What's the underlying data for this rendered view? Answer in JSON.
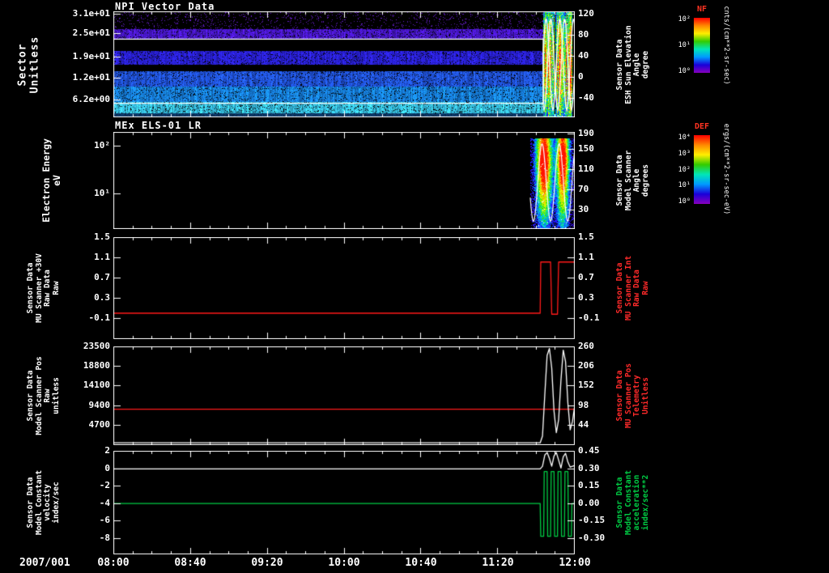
{
  "page": {
    "background": "#000000",
    "date_label": "2007/001",
    "x_tick_labels": [
      "08:00",
      "08:40",
      "09:20",
      "10:00",
      "10:40",
      "11:20",
      "12:00"
    ],
    "time_range_hours": [
      8,
      12
    ]
  },
  "colorbars": [
    {
      "name": "NF",
      "title": "NF",
      "title_color": "#ff3322",
      "unit": "cnts/(cm**2-sr-sec)",
      "tick_labels": [
        "10²",
        "10¹",
        "10⁰"
      ],
      "tick_fracs": [
        0.03,
        0.5,
        0.97
      ],
      "gradient": [
        "#ff0000",
        "#ff8800",
        "#ffee00",
        "#33cc00",
        "#00e6b8",
        "#0099ff",
        "#1a00d9",
        "#8800bb"
      ]
    },
    {
      "name": "DEF",
      "title": "DEF",
      "title_color": "#ff3322",
      "unit": "ergs/(cm**2-sr-sec-eV)",
      "tick_labels": [
        "10⁴",
        "10³",
        "10²",
        "10¹",
        "10⁰"
      ],
      "tick_fracs": [
        0.03,
        0.265,
        0.5,
        0.735,
        0.97
      ],
      "gradient": [
        "#ff0000",
        "#ff8800",
        "#ffee00",
        "#33cc00",
        "#00e6b8",
        "#0099ff",
        "#1a00d9",
        "#8800bb"
      ]
    }
  ],
  "chart_data": [
    {
      "type": "heatmap",
      "title": "NPI Vector Data",
      "ylabel_left": "Sector\nUnitless",
      "ylabel_right": "Sensor Data\nESH Sun Elevation\nAngle\ndegree",
      "ylabel_right_color": "#ffffff",
      "yticks_left": {
        "labels": [
          "3.1e+01",
          "2.5e+01",
          "1.9e+01",
          "1.2e+01",
          "6.2e+00"
        ],
        "fracs": [
          0.02,
          0.21,
          0.43,
          0.63,
          0.84
        ]
      },
      "yticks_right": {
        "labels": [
          "120",
          "80",
          "40",
          "0",
          "-40"
        ],
        "fracs": [
          0.02,
          0.22,
          0.42,
          0.62,
          0.82
        ]
      },
      "colorbar": "NF",
      "bands": [
        {
          "sector_frac": [
            0.0,
            0.17
          ],
          "level": "sparse",
          "color": [
            110,
            30,
            220
          ]
        },
        {
          "sector_frac": [
            0.17,
            0.265
          ],
          "level": "dense",
          "color": [
            80,
            25,
            225
          ]
        },
        {
          "sector_frac": [
            0.265,
            0.375
          ],
          "level": "off",
          "color": [
            0,
            0,
            0
          ]
        },
        {
          "sector_frac": [
            0.375,
            0.5
          ],
          "level": "dense",
          "color": [
            45,
            35,
            235
          ]
        },
        {
          "sector_frac": [
            0.5,
            0.565
          ],
          "level": "off",
          "color": [
            0,
            0,
            0
          ]
        },
        {
          "sector_frac": [
            0.565,
            0.71
          ],
          "level": "dense",
          "color": [
            35,
            90,
            240
          ]
        },
        {
          "sector_frac": [
            0.71,
            0.855
          ],
          "level": "dense",
          "color": [
            25,
            140,
            245
          ]
        },
        {
          "sector_frac": [
            0.855,
            0.965
          ],
          "level": "dense",
          "color": [
            60,
            210,
            250
          ]
        },
        {
          "sector_frac": [
            0.965,
            1.0
          ],
          "level": "dim",
          "color": [
            15,
            70,
            130
          ]
        }
      ],
      "event_x_hours": [
        11.73,
        12.0
      ],
      "overlay_lines": [
        {
          "color": "#ffffff",
          "const_frac": 0.262,
          "oscillates_in_event": true
        },
        {
          "color": "#ffffff",
          "const_frac": 0.868,
          "oscillates_in_event": true
        }
      ]
    },
    {
      "type": "heatmap",
      "title": "MEx ELS-01 LR",
      "ylabel_left": "Electron Energy\neV",
      "ylabel_right": "Sensor Data\nModel Scanner\nAngle\ndegrees",
      "ylabel_right_color": "#ffffff",
      "yticks_left": {
        "labels": [
          "10²",
          "10¹"
        ],
        "fracs": [
          0.14,
          0.64
        ]
      },
      "yticks_right": {
        "labels": [
          "190",
          "150",
          "110",
          "70",
          "30"
        ],
        "fracs": [
          0.02,
          0.175,
          0.39,
          0.6,
          0.81
        ]
      },
      "colorbar": "DEF",
      "event_x_hours": [
        11.62,
        12.0
      ],
      "event_blobs": [
        {
          "center_frac": 0.3,
          "width_frac": 0.16
        },
        {
          "center_frac": 0.72,
          "width_frac": 0.13
        }
      ],
      "overlay_lines": [
        {
          "color": "#ffffff",
          "oscillates_in_event": true
        }
      ]
    },
    {
      "type": "line",
      "title": "",
      "ylabel_left": "Sensor Data\nMU Scanner +30V\nRaw Data\nRaw",
      "ylabel_right": "Sensor Data\nMU Scanner Int\nRaw Data\nRaw",
      "ylabel_right_color": "#ff2a2a",
      "ylim": [
        -0.5,
        1.5
      ],
      "yticks_left": {
        "labels": [
          "1.5",
          "1.1",
          "0.7",
          "0.3",
          "-0.1"
        ],
        "values": [
          1.5,
          1.1,
          0.7,
          0.3,
          -0.1
        ]
      },
      "yticks_right": {
        "labels": [
          "1.5",
          "1.1",
          "0.7",
          "0.3",
          "-0.1"
        ],
        "values": [
          1.5,
          1.1,
          0.7,
          0.3,
          -0.1
        ]
      },
      "series": [
        {
          "name": "MU Scanner +30V Raw Data",
          "color": "#ff1a1a",
          "points": [
            [
              8,
              0
            ],
            [
              11.7,
              0
            ],
            [
              11.705,
              1.02
            ],
            [
              11.79,
              1.02
            ],
            [
              11.8,
              -0.02
            ],
            [
              11.85,
              -0.02
            ],
            [
              11.86,
              1.02
            ],
            [
              12,
              1.02
            ]
          ]
        }
      ]
    },
    {
      "type": "line",
      "title": "",
      "ylabel_left": "Sensor Data\nModel Scanner Pos\nRaw\nunitless",
      "ylabel_right": "Sensor Data\nMU Scanner Pos\nTelemetry\nUnitless",
      "ylabel_right_color": "#ff2a2a",
      "ylim": [
        0,
        23500
      ],
      "yticks_left": {
        "labels": [
          "23500",
          "18800",
          "14100",
          "9400",
          "4700"
        ],
        "values": [
          23500,
          18800,
          14100,
          9400,
          4700
        ]
      },
      "yticks_right": {
        "labels": [
          "260",
          "206",
          "152",
          "98",
          "44"
        ],
        "values": [
          23500,
          18800,
          14100,
          9400,
          4700
        ]
      },
      "series": [
        {
          "name": "Model Scanner Pos Raw",
          "color": "#ff1a1a",
          "points": [
            [
              8,
              8500
            ],
            [
              12,
              8500
            ]
          ]
        },
        {
          "name": "MU Scanner Pos Telemetry",
          "color": "#ffffff",
          "points": [
            [
              8,
              350
            ],
            [
              11.7,
              350
            ],
            [
              11.72,
              2000
            ],
            [
              11.74,
              12000
            ],
            [
              11.76,
              21500
            ],
            [
              11.78,
              23200
            ],
            [
              11.8,
              18500
            ],
            [
              11.82,
              8000
            ],
            [
              11.84,
              2800
            ],
            [
              11.86,
              6000
            ],
            [
              11.88,
              15500
            ],
            [
              11.9,
              22800
            ],
            [
              11.92,
              20000
            ],
            [
              11.94,
              10000
            ],
            [
              11.96,
              3500
            ],
            [
              11.98,
              5500
            ],
            [
              12,
              9500
            ]
          ]
        }
      ]
    },
    {
      "type": "line",
      "title": "",
      "ylabel_left": "Sensor Data\nModel Constant\nvelocity\nindex/sec",
      "ylabel_right": "Sensor Data\nModel Constant\nacceleration\nindex/sec**2",
      "ylabel_right_color": "#00cc44",
      "ylim": [
        -9.8,
        2
      ],
      "yticks_left": {
        "labels": [
          "2",
          "0",
          "-2",
          "-4",
          "-6",
          "-8"
        ],
        "values": [
          2,
          0,
          -2,
          -4,
          -6,
          -8
        ]
      },
      "yticks_right": {
        "labels": [
          "0.45",
          "0.30",
          "0.15",
          "0.00",
          "-0.15",
          "-0.30"
        ],
        "values": [
          2,
          0,
          -2,
          -4,
          -6,
          -8
        ]
      },
      "series": [
        {
          "name": "Model Constant velocity",
          "color": "#ffffff",
          "points": [
            [
              8,
              0
            ],
            [
              11.7,
              0
            ],
            [
              11.72,
              0.3
            ],
            [
              11.74,
              1.6
            ],
            [
              11.76,
              1.9
            ],
            [
              11.78,
              1.2
            ],
            [
              11.8,
              0.3
            ],
            [
              11.82,
              1.5
            ],
            [
              11.84,
              1.9
            ],
            [
              11.86,
              1.0
            ],
            [
              11.88,
              0.1
            ],
            [
              11.9,
              1.4
            ],
            [
              11.92,
              1.8
            ],
            [
              11.94,
              0.8
            ],
            [
              11.96,
              0.2
            ],
            [
              12,
              0.4
            ]
          ]
        },
        {
          "name": "Model Constant acceleration",
          "color": "#00cc44",
          "points": [
            [
              8,
              -4
            ],
            [
              11.7,
              -4
            ],
            [
              11.705,
              -7.8
            ],
            [
              11.73,
              -7.8
            ],
            [
              11.735,
              -0.3
            ],
            [
              11.76,
              -0.3
            ],
            [
              11.765,
              -7.8
            ],
            [
              11.79,
              -7.8
            ],
            [
              11.795,
              -0.3
            ],
            [
              11.82,
              -0.3
            ],
            [
              11.825,
              -7.8
            ],
            [
              11.85,
              -7.8
            ],
            [
              11.855,
              -0.3
            ],
            [
              11.88,
              -0.3
            ],
            [
              11.885,
              -7.8
            ],
            [
              11.91,
              -7.8
            ],
            [
              11.915,
              -0.3
            ],
            [
              11.94,
              -0.3
            ],
            [
              11.945,
              -7.8
            ],
            [
              11.97,
              -7.8
            ],
            [
              11.975,
              -4
            ],
            [
              12,
              -4
            ]
          ]
        }
      ]
    }
  ]
}
